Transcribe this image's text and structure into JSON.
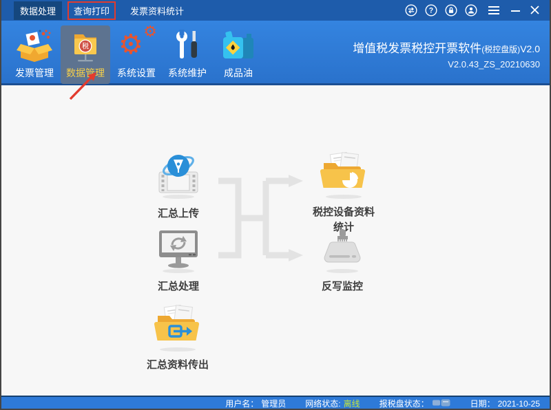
{
  "menu": {
    "items": [
      {
        "label": "数据处理"
      },
      {
        "label": "查询打印"
      },
      {
        "label": "发票资料统计"
      }
    ],
    "help_glyph": "?"
  },
  "toolbar": {
    "items": [
      {
        "label": "发票管理"
      },
      {
        "label": "数据管理",
        "icon_glyph": "税"
      },
      {
        "label": "系统设置",
        "icon_glyph": "⚙"
      },
      {
        "label": "系统维护"
      },
      {
        "label": "成品油"
      }
    ],
    "title_main": "增值税发票税控开票软件",
    "title_small": "(税控盘版)",
    "title_version_inline": "V2.0",
    "version_line": "V2.0.43_ZS_20210630"
  },
  "main": {
    "modules": [
      {
        "name": "summary-upload",
        "lines": [
          "汇总上传"
        ]
      },
      {
        "name": "tax-device-statistics",
        "lines": [
          "税控设备资料",
          "统计"
        ]
      },
      {
        "name": "summary-processing",
        "lines": [
          "汇总处理"
        ]
      },
      {
        "name": "writeback-monitor",
        "lines": [
          "反写监控"
        ]
      },
      {
        "name": "summary-export",
        "lines": [
          "汇总资料传出"
        ]
      }
    ]
  },
  "statusbar": {
    "username_label": "用户名：",
    "username_value": "管理员",
    "network_label": "网络状态:",
    "network_value": "离线",
    "taxdisk_label": "报税盘状态：",
    "date_label": "日期：",
    "date_value": "2021-10-25"
  },
  "colors": {
    "titlebar_blue": "#1e5cab",
    "toolbar_blue": "#2e78d2",
    "annotation_red": "#e23b2e",
    "selected_item_bg": "#5d7390",
    "selected_item_text": "#f6cf4a",
    "network_status_green": "#c6e53a",
    "statusbar_blue": "#2e7ad8"
  }
}
